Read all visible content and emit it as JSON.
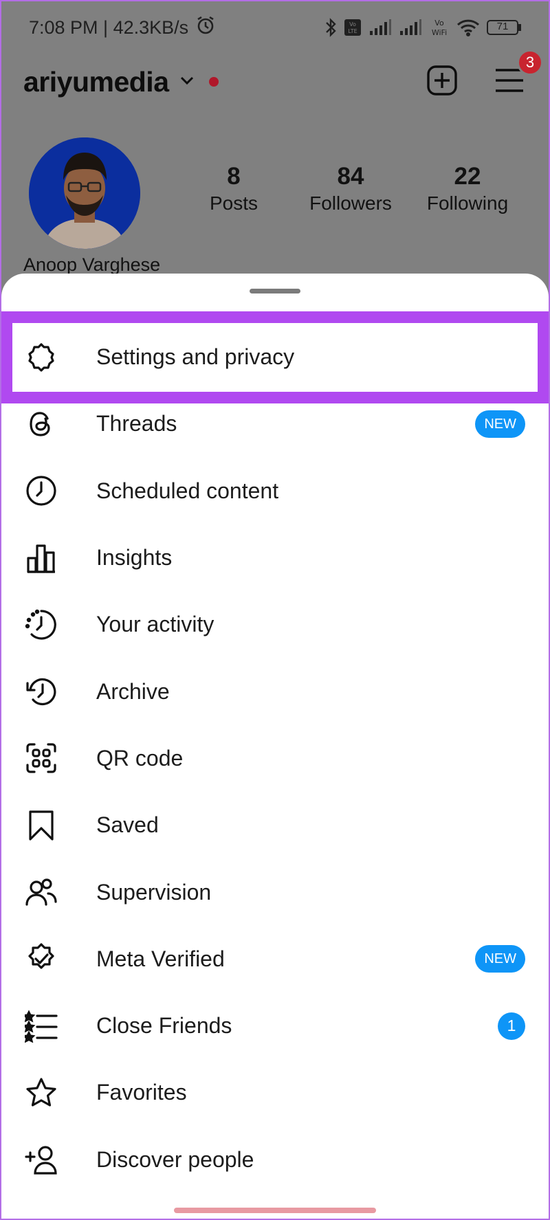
{
  "status_bar": {
    "time_speed": "7:08 PM | 42.3KB/s",
    "battery": "71",
    "icons": [
      "alarm-icon",
      "bluetooth-icon",
      "volte-icon",
      "signal-icon",
      "vowifi-icon",
      "wifi-icon",
      "battery-icon"
    ]
  },
  "header": {
    "username": "ariyumedia",
    "notification_count": "3",
    "icons": [
      "chevron-down-icon",
      "add-post-icon",
      "menu-icon"
    ]
  },
  "profile": {
    "name": "Anoop Varghese",
    "stats": [
      {
        "value": "8",
        "label": "Posts"
      },
      {
        "value": "84",
        "label": "Followers"
      },
      {
        "value": "22",
        "label": "Following"
      }
    ]
  },
  "colors": {
    "highlight": "#b049f0",
    "badge_blue": "#0e95f7",
    "badge_red": "#c8242f"
  },
  "menu": {
    "items": [
      {
        "label": "Settings and privacy",
        "icon": "gear-icon",
        "badge": ""
      },
      {
        "label": "Threads",
        "icon": "threads-icon",
        "badge": "NEW"
      },
      {
        "label": "Scheduled content",
        "icon": "clock-icon",
        "badge": ""
      },
      {
        "label": "Insights",
        "icon": "bar-chart-icon",
        "badge": ""
      },
      {
        "label": "Your activity",
        "icon": "activity-icon",
        "badge": ""
      },
      {
        "label": "Archive",
        "icon": "archive-icon",
        "badge": ""
      },
      {
        "label": "QR code",
        "icon": "qr-code-icon",
        "badge": ""
      },
      {
        "label": "Saved",
        "icon": "bookmark-icon",
        "badge": ""
      },
      {
        "label": "Supervision",
        "icon": "supervision-icon",
        "badge": ""
      },
      {
        "label": "Meta Verified",
        "icon": "verified-icon",
        "badge": "NEW"
      },
      {
        "label": "Close Friends",
        "icon": "close-friends-icon",
        "badge": "1"
      },
      {
        "label": "Favorites",
        "icon": "star-icon",
        "badge": ""
      },
      {
        "label": "Discover people",
        "icon": "add-person-icon",
        "badge": ""
      }
    ]
  }
}
